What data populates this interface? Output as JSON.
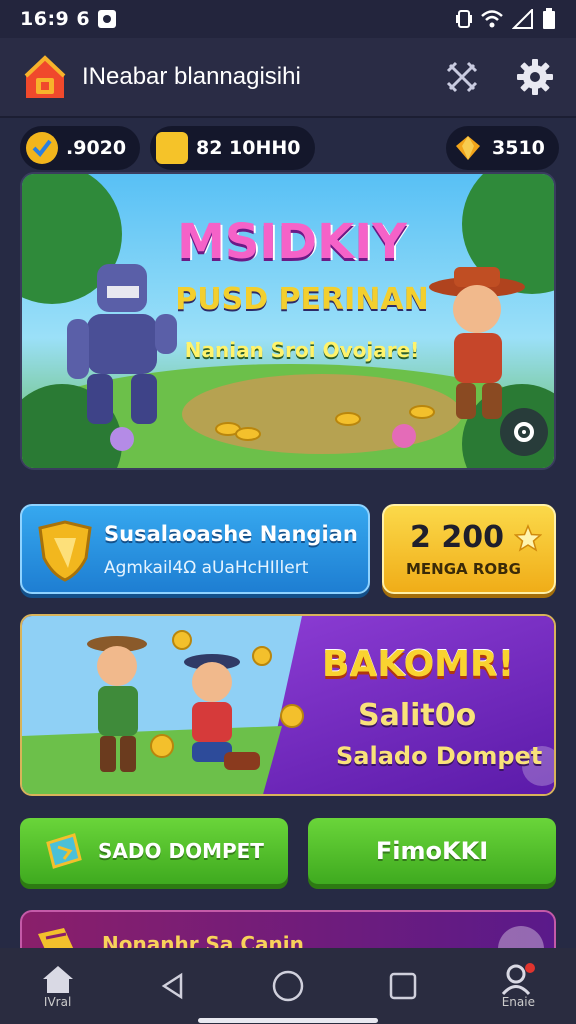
{
  "status_bar": {
    "time": "16:9 6"
  },
  "app_bar": {
    "title": "INeabar blannagisihi"
  },
  "currencies": [
    {
      "value": ".9020",
      "color": "#f2b51c"
    },
    {
      "value": "82 10HH0",
      "color": "#f5c329"
    },
    {
      "value": "3510",
      "color": "#f2a41a"
    }
  ],
  "hero": {
    "title": "MSIDKIY",
    "subtitle": "PUSD PERINAN",
    "tagline": "Nanian Sroi Ovojare!"
  },
  "balance_card": {
    "line1": "Susalaoashe Nangian",
    "line2": "Agmkail4Ω aUaHcHIllert"
  },
  "score_card": {
    "value": "2 200",
    "label": "MENGA ROBG"
  },
  "promo": {
    "title": "BAKOMR!",
    "subtitle": "Salit0o",
    "footer": "Salado Dompet"
  },
  "buttons": {
    "left": "SADO DOMPET",
    "right": "FimoKKI"
  },
  "bottom_card": {
    "title": "Nonanhr Sa Canin"
  },
  "nav": {
    "home_label": "IVral",
    "profile_label": "Enaie"
  },
  "colors": {
    "accent_green": "#5cc82a",
    "accent_blue": "#2a8fe0",
    "accent_yellow": "#f6c12a",
    "accent_purple": "#7a2fc0"
  }
}
